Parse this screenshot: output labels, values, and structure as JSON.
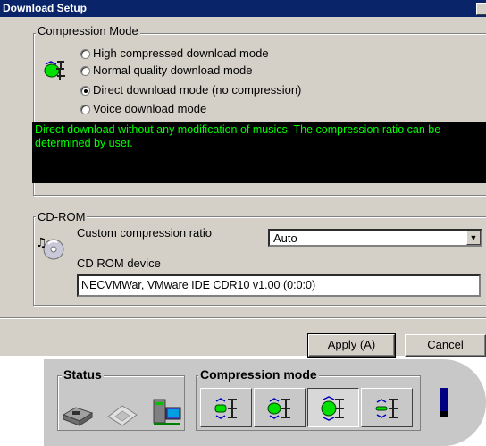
{
  "dialog": {
    "title": "Download Setup",
    "compression": {
      "group_title": "Compression Mode",
      "options": [
        {
          "label": "High compressed download mode",
          "checked": false
        },
        {
          "label": "Normal quality download mode",
          "checked": false
        },
        {
          "label": "Direct download mode (no compression)",
          "checked": true
        },
        {
          "label": "Voice download mode",
          "checked": false
        }
      ],
      "description": "Direct download without any modification of musics. The compression ratio can be determined by user."
    },
    "cdrom": {
      "group_title": "CD-ROM",
      "ratio_label": "Custom compression ratio",
      "ratio_value": "Auto",
      "device_label": "CD ROM device",
      "device_value": "NECVMWar, VMware IDE CDR10 v1.00 (0:0:0)"
    },
    "buttons": {
      "apply": "Apply (A)",
      "cancel": "Cancel"
    }
  },
  "toolbar": {
    "status_title": "Status",
    "compression_title": "Compression mode",
    "status_icons": [
      "player-connect-icon",
      "memory-card-icon",
      "pc-connection-icon"
    ],
    "compression_buttons": [
      {
        "icon": "high-compression-icon",
        "pressed": false
      },
      {
        "icon": "normal-quality-icon",
        "pressed": false
      },
      {
        "icon": "direct-download-icon",
        "pressed": true
      },
      {
        "icon": "voice-download-icon",
        "pressed": false
      }
    ]
  }
}
